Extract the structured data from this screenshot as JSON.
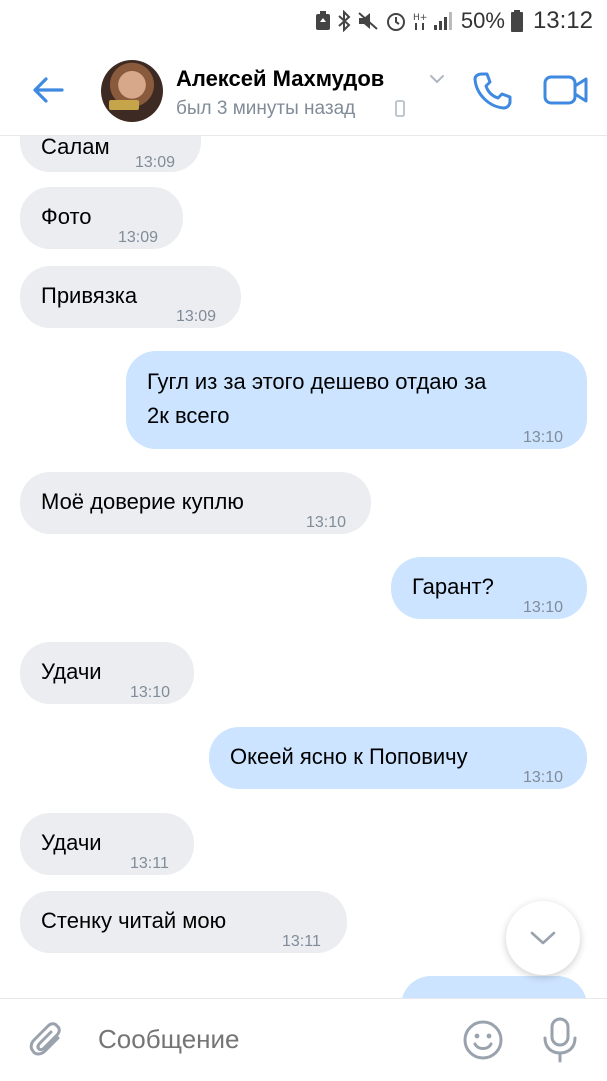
{
  "status_bar": {
    "battery": "50%",
    "time": "13:12"
  },
  "header": {
    "contact_name": "Алексей Махмудов",
    "last_seen": "был 3 минуты назад"
  },
  "messages": [
    {
      "text": "Салам",
      "time": "13:09",
      "dir": "in"
    },
    {
      "text": "Фото",
      "time": "13:09",
      "dir": "in"
    },
    {
      "text": "Привязка",
      "time": "13:09",
      "dir": "in"
    },
    {
      "text_line1": "Гугл из за этого дешево отдаю за",
      "text_line2": "2к всего",
      "time": "13:10",
      "dir": "out"
    },
    {
      "text": "Моё доверие куплю",
      "time": "13:10",
      "dir": "in"
    },
    {
      "text": "Гарант?",
      "time": "13:10",
      "dir": "out"
    },
    {
      "text": "Удачи",
      "time": "13:10",
      "dir": "in"
    },
    {
      "text": "Океей ясно к Поповичу",
      "time": "13:10",
      "dir": "out"
    },
    {
      "text": "Удачи",
      "time": "13:11",
      "dir": "in"
    },
    {
      "text": "Стенку читай мою",
      "time": "13:11",
      "dir": "in"
    }
  ],
  "composer": {
    "placeholder": "Сообщение"
  },
  "colors": {
    "accent": "#3f8ae0",
    "incoming_bubble": "#ebedf0",
    "outgoing_bubble": "#cce4ff",
    "secondary_text": "#818c99"
  }
}
